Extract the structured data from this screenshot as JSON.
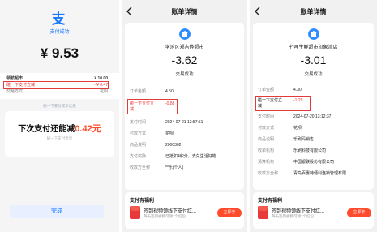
{
  "colors": {
    "accent": "#1677ff",
    "discount_red": "#e8332a",
    "claim_button": "#ff4a2c",
    "highlight_box": "#e23b3b"
  },
  "payment_success": {
    "logo_icon": "alipay-logo-icon",
    "status": "支付成功",
    "amount": "¥ 9.53",
    "rows": [
      {
        "label": "领航超市",
        "value": "¥ 10.00"
      },
      {
        "label": "碰一下支付立减",
        "value": "- ¥ 0.47"
      },
      {
        "label": "交易方式",
        "value": "花呗"
      }
    ],
    "tip": "碰一下支付常享优惠",
    "next_time_prefix": "下次支付还能减",
    "next_time_amount": "0.42元",
    "next_time_sub": "碰一下支付专享",
    "done_button": "完成"
  },
  "bill_a": {
    "title": "账单详情",
    "merchant_icon": "merchant-avatar-icon",
    "merchant": "李沧区郑吉烨超市",
    "amount": "-3.62",
    "status": "交易成功",
    "fields": [
      {
        "label": "订单金额",
        "value": "4.50"
      },
      {
        "label": "碰一下支付立减",
        "value": "-0.88"
      },
      {
        "label": "支付时间",
        "value": "2024-07-21 12:57:51"
      },
      {
        "label": "付款方式",
        "value": "花呗"
      },
      {
        "label": "商品说明",
        "value": "2000302"
      },
      {
        "label": "支付奖励",
        "value": "已抵扣4积分，去兑生活好物"
      },
      {
        "label": "收款方全称",
        "value": "**乐(个人)"
      }
    ],
    "benefit_title": "支付有福利",
    "benefit_main": "签到视频领线下支付红...",
    "benefit_sub": "每天签到视频可领1个红包",
    "claim_button": "立即去"
  },
  "bill_b": {
    "title": "账单详情",
    "merchant_icon": "merchant-avatar-icon",
    "merchant": "七哩生鲜超市印象湾店",
    "amount": "-3.01",
    "status": "交易成功",
    "fields": [
      {
        "label": "订单金额",
        "value": "4.30"
      },
      {
        "label": "碰一下支付立减",
        "value": "-1.29"
      },
      {
        "label": "支付时间",
        "value": "2024-07-20 13:12:37"
      },
      {
        "label": "付款方式",
        "value": "花呗"
      },
      {
        "label": "商品说明",
        "value": "乐刷码销售"
      },
      {
        "label": "收单机构",
        "value": "乐刷科技有限公司"
      },
      {
        "label": "清算机构",
        "value": "中国银联股份有限公司"
      },
      {
        "label": "收款方全称",
        "value": "青岛百惠特便利连锁管理有限"
      }
    ],
    "benefit_title": "支付有福利",
    "benefit_main": "签到视频领线下支付红...",
    "benefit_sub": "每天签到视频可领1个红包",
    "claim_button": "立即去"
  }
}
